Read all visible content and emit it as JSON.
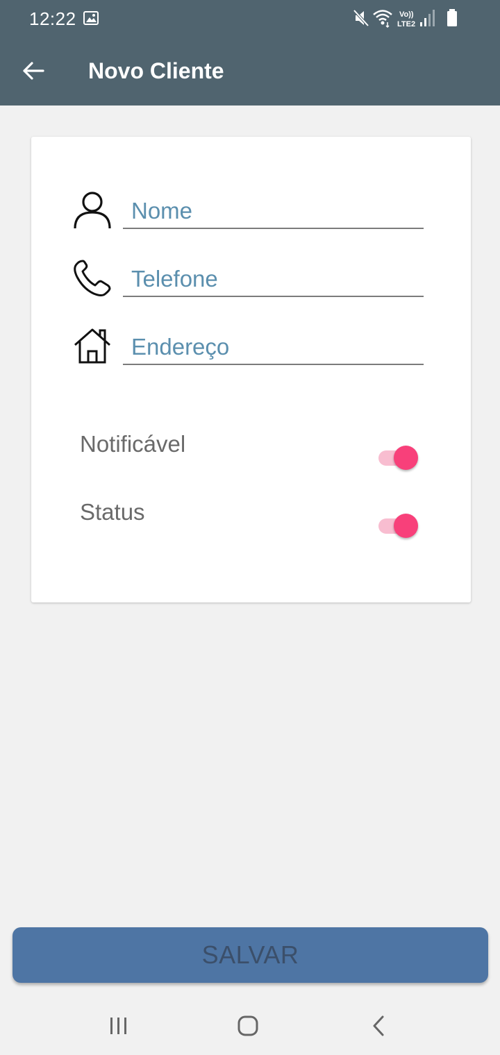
{
  "status_bar": {
    "time": "12:22",
    "icons": [
      "gallery-icon",
      "mute-icon",
      "wifi-icon",
      "volte-lte2-icon",
      "signal-icon",
      "battery-icon"
    ],
    "volte_top": "Vo))",
    "volte_bottom": "LTE2"
  },
  "app_bar": {
    "title": "Novo Cliente",
    "back_icon": "arrow-left-icon",
    "color": "#50646f"
  },
  "form": {
    "fields": [
      {
        "icon": "person-icon",
        "placeholder": "Nome",
        "value": ""
      },
      {
        "icon": "phone-icon",
        "placeholder": "Telefone",
        "value": ""
      },
      {
        "icon": "home-icon",
        "placeholder": "Endereço",
        "value": ""
      }
    ],
    "toggles": [
      {
        "label": "Notificável",
        "on": true
      },
      {
        "label": "Status",
        "on": true
      }
    ],
    "accent": "#f8407a"
  },
  "save_button": {
    "label": "SALVAR",
    "color": "#4e75a4"
  },
  "nav_bar": {
    "buttons": [
      "recent-apps-icon",
      "home-button-icon",
      "back-nav-icon"
    ]
  }
}
